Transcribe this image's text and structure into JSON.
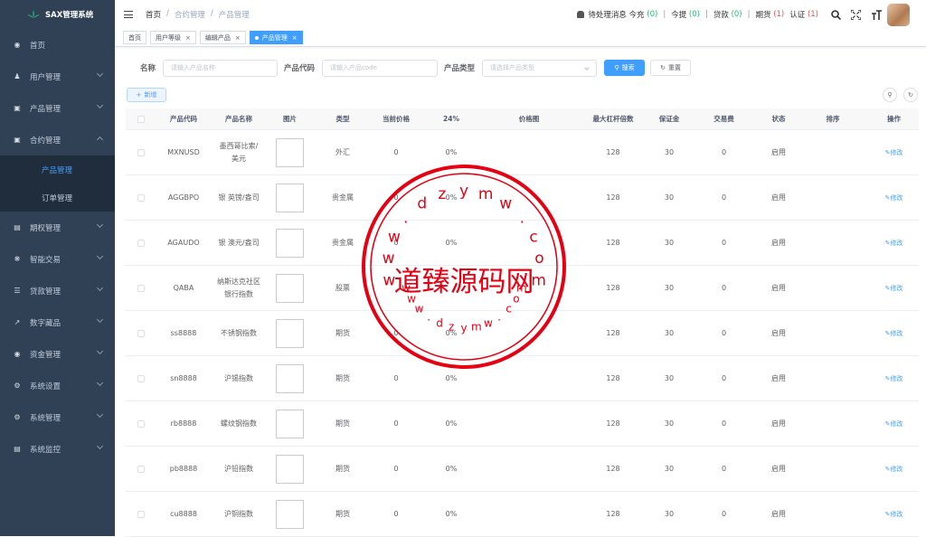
{
  "app": {
    "title": "SAX管理系统"
  },
  "sidebar": {
    "items": [
      {
        "label": "首页",
        "icon": "dashboard-icon"
      },
      {
        "label": "用户管理",
        "icon": "user-icon"
      },
      {
        "label": "产品管理",
        "icon": "document-icon"
      },
      {
        "label": "合约管理",
        "icon": "document-icon"
      },
      {
        "label": "期权管理",
        "icon": "chart-icon"
      },
      {
        "label": "智能交易",
        "icon": "gear-icon"
      },
      {
        "label": "贷款管理",
        "icon": "loan-icon"
      },
      {
        "label": "数字藏品",
        "icon": "trend-icon"
      },
      {
        "label": "资金管理",
        "icon": "money-icon"
      },
      {
        "label": "系统设置",
        "icon": "gear-icon"
      },
      {
        "label": "系统管理",
        "icon": "gear-icon"
      },
      {
        "label": "系统监控",
        "icon": "monitor-icon"
      }
    ],
    "submenu": [
      {
        "label": "产品管理"
      },
      {
        "label": "订单管理"
      }
    ]
  },
  "breadcrumb": {
    "home": "首页",
    "level1": "合约管理",
    "level2": "产品管理",
    "sep": "/"
  },
  "header": {
    "pending": "待处理消息 今充",
    "recharge_count": "(0)",
    "withdraw_label": "今提",
    "withdraw_count": "(0)",
    "loan_label": "贷款",
    "loan_count": "(0)",
    "futures_label": "期货",
    "futures_count": "(1)",
    "auth_label": "认证",
    "auth_count": "(1)",
    "sep": "|"
  },
  "tags": [
    {
      "label": "首页"
    },
    {
      "label": "用户等级"
    },
    {
      "label": "编辑产品"
    },
    {
      "label": "产品管理"
    }
  ],
  "search": {
    "name_label": "名称",
    "name_placeholder": "请输入产品名称",
    "code_label": "产品代码",
    "code_placeholder": "请输入产品code",
    "type_label": "产品类型",
    "type_placeholder": "请选择产品类型",
    "search_btn": "搜索",
    "reset_btn": "重置"
  },
  "toolbar": {
    "add_label": "新增"
  },
  "table": {
    "columns": [
      "产品代码",
      "产品名称",
      "图片",
      "类型",
      "当前价格",
      "24%",
      "价格图",
      "最大杠杆倍数",
      "保证金",
      "交易费",
      "状态",
      "排序",
      "操作"
    ],
    "edit_label": "修改",
    "rows": [
      {
        "code": "MXNUSD",
        "name": "墨西哥比索/美元",
        "type": "外汇",
        "price": "0",
        "pct": "0%",
        "leverage": "128",
        "margin": "30",
        "fee": "0",
        "status": "启用"
      },
      {
        "code": "AGGBPO",
        "name": "银 英镑/盎司",
        "type": "贵金属",
        "price": "0",
        "pct": "0%",
        "leverage": "128",
        "margin": "30",
        "fee": "0",
        "status": "启用"
      },
      {
        "code": "AGAUDO",
        "name": "银 澳元/盎司",
        "type": "贵金属",
        "price": "0",
        "pct": "0%",
        "leverage": "128",
        "margin": "30",
        "fee": "0",
        "status": "启用"
      },
      {
        "code": "QABA",
        "name": "纳斯达克社区银行指数",
        "type": "股票",
        "price": "",
        "pct": "",
        "leverage": "128",
        "margin": "30",
        "fee": "0",
        "status": "启用"
      },
      {
        "code": "ss8888",
        "name": "不锈钢指数",
        "type": "期货",
        "price": "0",
        "pct": "0%",
        "leverage": "128",
        "margin": "30",
        "fee": "0",
        "status": "启用"
      },
      {
        "code": "sn8888",
        "name": "沪锡指数",
        "type": "期货",
        "price": "0",
        "pct": "0%",
        "leverage": "128",
        "margin": "30",
        "fee": "0",
        "status": "启用"
      },
      {
        "code": "rb8888",
        "name": "螺纹钢指数",
        "type": "期货",
        "price": "0",
        "pct": "0%",
        "leverage": "128",
        "margin": "30",
        "fee": "0",
        "status": "启用"
      },
      {
        "code": "pb8888",
        "name": "沪铅指数",
        "type": "期货",
        "price": "0",
        "pct": "0%",
        "leverage": "128",
        "margin": "30",
        "fee": "0",
        "status": "启用"
      },
      {
        "code": "cu8888",
        "name": "沪铜指数",
        "type": "期货",
        "price": "0",
        "pct": "0%",
        "leverage": "128",
        "margin": "30",
        "fee": "0",
        "status": "启用"
      }
    ]
  },
  "watermark": {
    "name": "道臻源码网",
    "url": "www.dzymw.com"
  },
  "colors": {
    "sidebar": "#304156",
    "accent": "#409eff",
    "green": "#13ce66",
    "red": "#ff4949",
    "stamp": "#e60012"
  }
}
